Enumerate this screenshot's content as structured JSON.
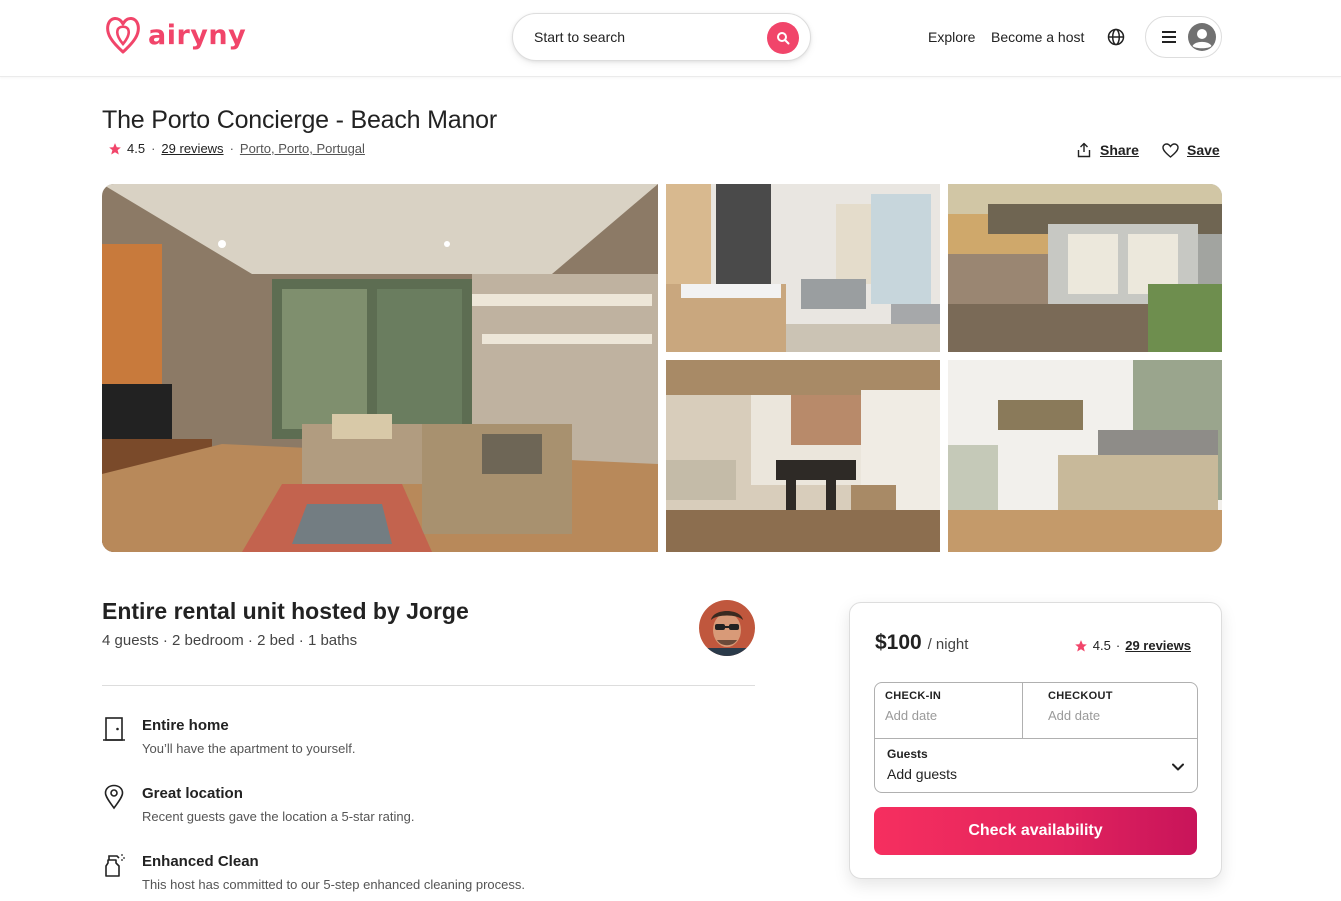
{
  "brand": {
    "name": "airyny",
    "color": "#f1456a"
  },
  "header": {
    "search_placeholder": "Start to search",
    "nav": {
      "explore": "Explore",
      "become_host": "Become a host"
    },
    "icons": {
      "search": "search-icon",
      "globe": "globe-icon",
      "menu": "menu-icon",
      "user": "user-avatar-icon"
    }
  },
  "listing": {
    "title": "The Porto Concierge - Beach Manor",
    "rating": "4.5",
    "reviews_label": "29 reviews",
    "location": "Porto, Porto, Portugal",
    "share_label": "Share",
    "save_label": "Save"
  },
  "host": {
    "title": "Entire rental unit hosted by Jorge",
    "details": "4 guests · 2 bedroom · 2 bed · 1 baths"
  },
  "features": [
    {
      "icon": "door-icon",
      "title": "Entire home",
      "description": "You’ll have the apartment to yourself."
    },
    {
      "icon": "map-pin-icon",
      "title": "Great location",
      "description": "Recent guests gave the location a 5-star rating."
    },
    {
      "icon": "spray-bottle-icon",
      "title": "Enhanced Clean",
      "description": "This host has committed to our 5-step enhanced cleaning process."
    }
  ],
  "booking": {
    "price": "$100",
    "per_night": "/ night",
    "rating": "4.5",
    "reviews_label": "29 reviews",
    "checkin_label": "CHECK-IN",
    "checkin_placeholder": "Add date",
    "checkout_label": "CHECKOUT",
    "checkout_placeholder": "Add date",
    "guests_label": "Guests",
    "guests_placeholder": "Add guests",
    "cta_label": "Check availability"
  }
}
